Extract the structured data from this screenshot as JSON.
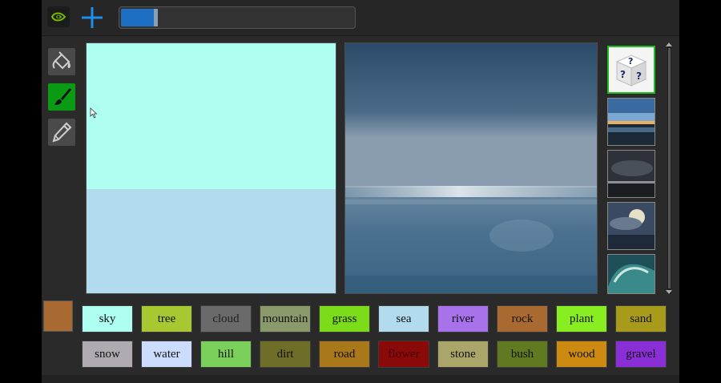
{
  "toolbar": {
    "logo_icon": "nvidia-eye-icon",
    "add_icon": "plus-icon",
    "progress": 0.14,
    "accent": "#1d6fc4"
  },
  "tools": [
    {
      "name": "paint-bucket",
      "icon": "paint-bucket-icon",
      "active": false
    },
    {
      "name": "brush",
      "icon": "brush-icon",
      "active": true
    },
    {
      "name": "pencil",
      "icon": "pencil-icon",
      "active": false
    }
  ],
  "segmentation": {
    "regions": [
      {
        "label": "sky",
        "color": "#aefef1"
      },
      {
        "label": "sea",
        "color": "#b2dcee"
      }
    ]
  },
  "thumbnails": [
    {
      "name": "random-style",
      "icon": "dice-icon",
      "selected": true
    },
    {
      "name": "sunset-beach",
      "selected": false
    },
    {
      "name": "dark-clouds",
      "selected": false
    },
    {
      "name": "cloudy-sun",
      "selected": false
    },
    {
      "name": "wave",
      "selected": false
    }
  ],
  "current_color": "#a86a30",
  "palette": [
    {
      "label": "sky",
      "color": "#aefef1",
      "text": "#111111"
    },
    {
      "label": "tree",
      "color": "#a8c832",
      "text": "#111111"
    },
    {
      "label": "cloud",
      "color": "#6a6a6a",
      "text": "#222222"
    },
    {
      "label": "mountain",
      "color": "#8a9a6a",
      "text": "#111111"
    },
    {
      "label": "grass",
      "color": "#7ddc1a",
      "text": "#111111"
    },
    {
      "label": "sea",
      "color": "#b2dcee",
      "text": "#111111"
    },
    {
      "label": "river",
      "color": "#a872ea",
      "text": "#111111"
    },
    {
      "label": "rock",
      "color": "#a86a30",
      "text": "#111111"
    },
    {
      "label": "plant",
      "color": "#88ee22",
      "text": "#111111"
    },
    {
      "label": "sand",
      "color": "#a89a1a",
      "text": "#111111"
    },
    {
      "label": "snow",
      "color": "#b0aab2",
      "text": "#111111"
    },
    {
      "label": "water",
      "color": "#cbdcff",
      "text": "#111111"
    },
    {
      "label": "hill",
      "color": "#7ad05a",
      "text": "#111111"
    },
    {
      "label": "dirt",
      "color": "#6e6e28",
      "text": "#111111"
    },
    {
      "label": "road",
      "color": "#a8781a",
      "text": "#111111"
    },
    {
      "label": "flower",
      "color": "#8a0a0a",
      "text": "#4a0000"
    },
    {
      "label": "stone",
      "color": "#aaa66a",
      "text": "#111111"
    },
    {
      "label": "bush",
      "color": "#607a22",
      "text": "#111111"
    },
    {
      "label": "wood",
      "color": "#cc8a10",
      "text": "#111111"
    },
    {
      "label": "gravel",
      "color": "#8a2ed6",
      "text": "#111111"
    }
  ]
}
